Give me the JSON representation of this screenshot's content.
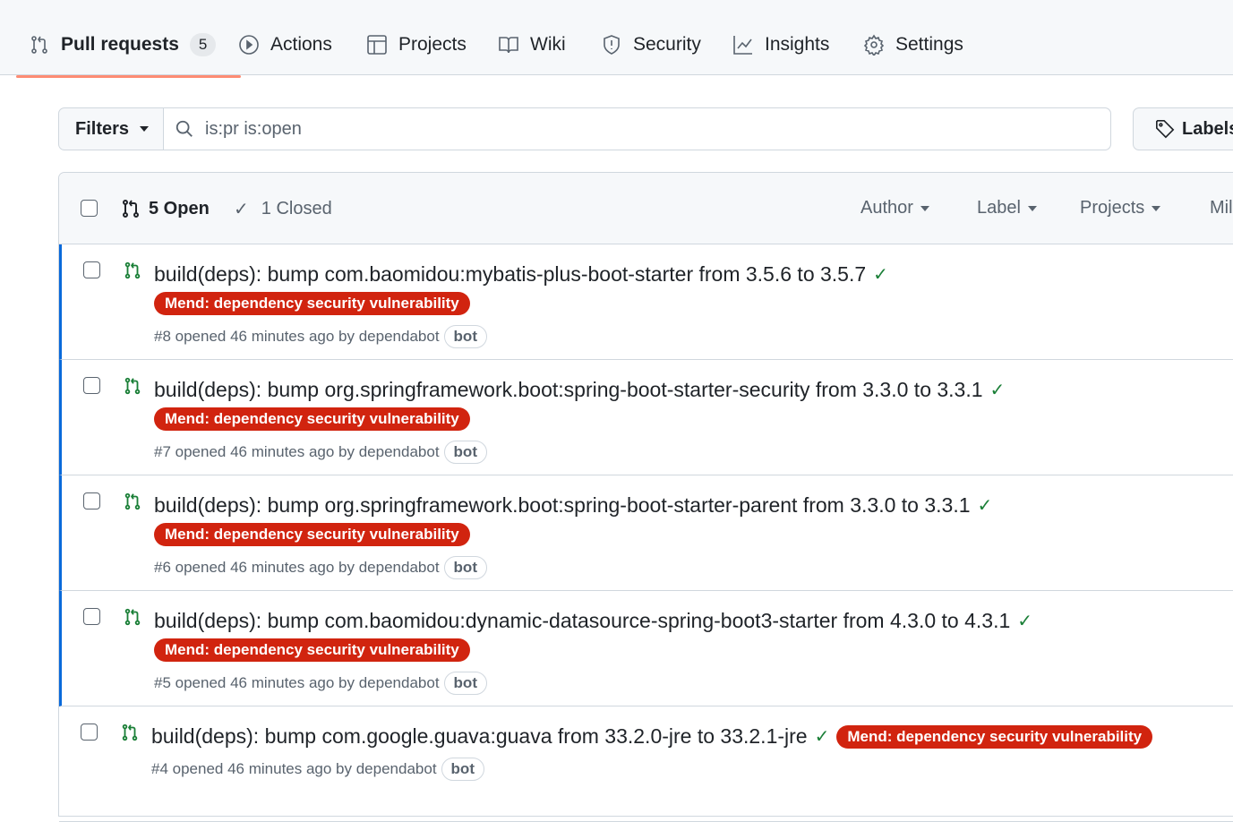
{
  "nav": {
    "tabs": [
      {
        "label": "Pull requests",
        "count": "5",
        "icon": "git-pull-request-icon"
      },
      {
        "label": "Actions",
        "icon": "play-icon"
      },
      {
        "label": "Projects",
        "icon": "table-icon"
      },
      {
        "label": "Wiki",
        "icon": "book-icon"
      },
      {
        "label": "Security",
        "icon": "shield-icon"
      },
      {
        "label": "Insights",
        "icon": "graph-icon"
      },
      {
        "label": "Settings",
        "icon": "gear-icon"
      }
    ]
  },
  "filters": {
    "label": "Filters",
    "query": "is:pr is:open",
    "labels_button": "Labels"
  },
  "list": {
    "open": "5 Open",
    "closed": "1 Closed",
    "author": "Author",
    "label": "Label",
    "projects": "Projects",
    "milestones": "Mil"
  },
  "label_color": "#d1240f",
  "prs": [
    {
      "title": "build(deps): bump com.baomidou:mybatis-plus-boot-starter from 3.5.6 to 3.5.7",
      "label": "Mend: dependency security vulnerability",
      "meta": "#8 opened 46 minutes ago by dependabot",
      "badge": "bot"
    },
    {
      "title": "build(deps): bump org.springframework.boot:spring-boot-starter-security from 3.3.0 to 3.3.1",
      "label": "Mend: dependency security vulnerability",
      "meta": "#7 opened 46 minutes ago by dependabot",
      "badge": "bot"
    },
    {
      "title": "build(deps): bump org.springframework.boot:spring-boot-starter-parent from 3.3.0 to 3.3.1",
      "label": "Mend: dependency security vulnerability",
      "meta": "#6 opened 46 minutes ago by dependabot",
      "badge": "bot"
    },
    {
      "title": "build(deps): bump com.baomidou:dynamic-datasource-spring-boot3-starter from 4.3.0 to 4.3.1",
      "label": "Mend: dependency security vulnerability",
      "meta": "#5 opened 46 minutes ago by dependabot",
      "badge": "bot"
    },
    {
      "title": "build(deps): bump com.google.guava:guava from 33.2.0-jre to 33.2.1-jre",
      "label": "Mend: dependency security vulnerability",
      "meta": "#4 opened 46 minutes ago by dependabot",
      "badge": "bot"
    }
  ]
}
